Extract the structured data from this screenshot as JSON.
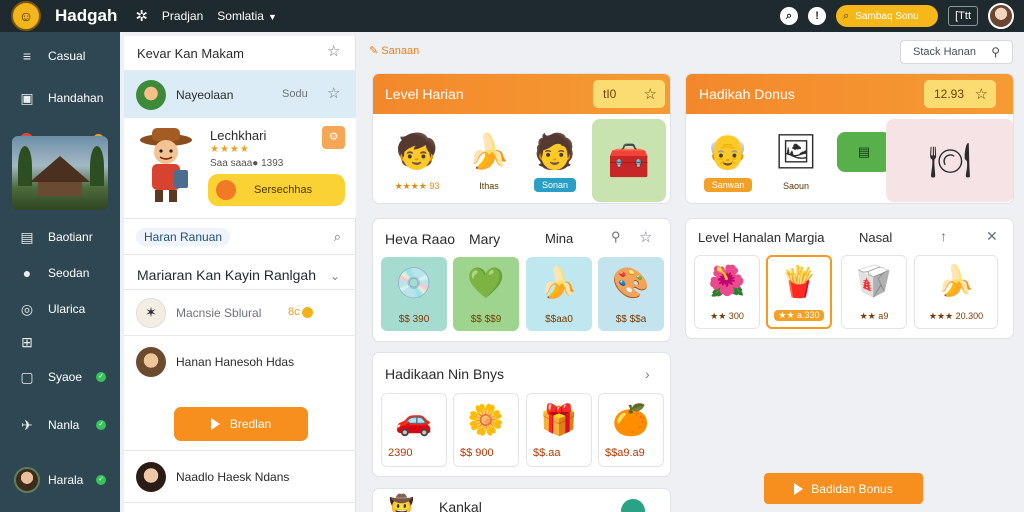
{
  "topbar": {
    "title": "Hadgah",
    "nav": [
      "Pradjan",
      "Somlatia"
    ],
    "search_label": "Sambaq Sonu",
    "box_label": "[Ttt"
  },
  "sidebar": {
    "items": [
      {
        "label": "Casual",
        "icon": "menu-icon"
      },
      {
        "label": "Handahan",
        "icon": "book-icon"
      },
      {
        "label": "Baotianr",
        "icon": "calendar-icon"
      },
      {
        "label": "Seodan",
        "icon": "user-icon"
      },
      {
        "label": "Ularica",
        "icon": "globe-icon"
      },
      {
        "label": "",
        "icon": "grid-icon"
      },
      {
        "label": "Syaoe",
        "icon": "image-icon"
      },
      {
        "label": "Nanla",
        "icon": "plane-icon"
      },
      {
        "label": "Harala",
        "icon": "avatar"
      }
    ]
  },
  "list": {
    "header": "Kevar Kan Makam",
    "selected_row": {
      "title": "Nayeolaan",
      "sub": "Sodu"
    },
    "card": {
      "title": "Lechkhari",
      "stars": "★★★★",
      "meta": "Saa saaa● 1393",
      "button": "Sersechhas"
    },
    "filter_label": "Haran Ranuan",
    "section_title": "Mariaran Kan Kayin Ranlgah",
    "rows": [
      {
        "title": "Macnsie Sblural",
        "value": "8c"
      },
      {
        "title": "Hanan Hanesoh Hdas"
      },
      {
        "title": "Naadlo Haesk Ndans"
      }
    ],
    "play_button": "Bredlan"
  },
  "main": {
    "breadcrumb": "Sanaan",
    "stack_search": "Stack Hanan",
    "level_panel": {
      "title": "Level Harian",
      "score": "tI0",
      "items": [
        {
          "icon": "boy-character-icon",
          "label": "★★★★ 93"
        },
        {
          "icon": "banana-bowl-icon",
          "label": "Ithas"
        },
        {
          "icon": "explorer-character-icon",
          "label": "Sonan"
        },
        {
          "icon": "treasure-chest-icon",
          "label": ""
        }
      ]
    },
    "hadikah_panel": {
      "title": "Hadikah Donus",
      "score": "12.93",
      "items": [
        {
          "icon": "grandpa-character-icon",
          "label": "Sanwan"
        },
        {
          "icon": "picture-frame-icon",
          "label": "Saoun"
        },
        {
          "icon": "green-ticket-icon",
          "label": ""
        },
        {
          "icon": "bonus-card-icon",
          "label": ""
        }
      ]
    },
    "heva_panel": {
      "title": "Heva Raao",
      "col2": "Mary",
      "col3": "Mina",
      "tiles": [
        {
          "icon": "disc-icon",
          "label": "$$ 390"
        },
        {
          "icon": "green-gem-icon",
          "label": "$$ $$9"
        },
        {
          "icon": "banana-bowl-icon",
          "label": "$$aa0"
        },
        {
          "icon": "pattern-icon",
          "label": "$$ $$a"
        }
      ]
    },
    "gift_panel": {
      "title": "Hadikaan Nin Bnys",
      "cards": [
        {
          "icon": "red-car-icon",
          "label": "2390"
        },
        {
          "icon": "orange-flower-icon",
          "label": "$$ 900"
        },
        {
          "icon": "gift-box-icon",
          "label": "$$.aa"
        },
        {
          "icon": "orange-fruit-icon",
          "label": "$$a9.a9"
        }
      ]
    },
    "bonus_panel": {
      "title": "Level Hanalan Margia",
      "col2": "Nasal",
      "items": [
        {
          "icon": "red-flowers-icon",
          "label": "★★ 300"
        },
        {
          "icon": "red-sticks-icon",
          "label": "★★ a.330"
        },
        {
          "icon": "fries-icon",
          "label": "★★ a9"
        },
        {
          "icon": "banana-bunch-icon",
          "label": "★★★ 20.300"
        }
      ]
    },
    "bottom_panel_title": "Kankal",
    "bonus_button": "Badidan Bonus"
  }
}
